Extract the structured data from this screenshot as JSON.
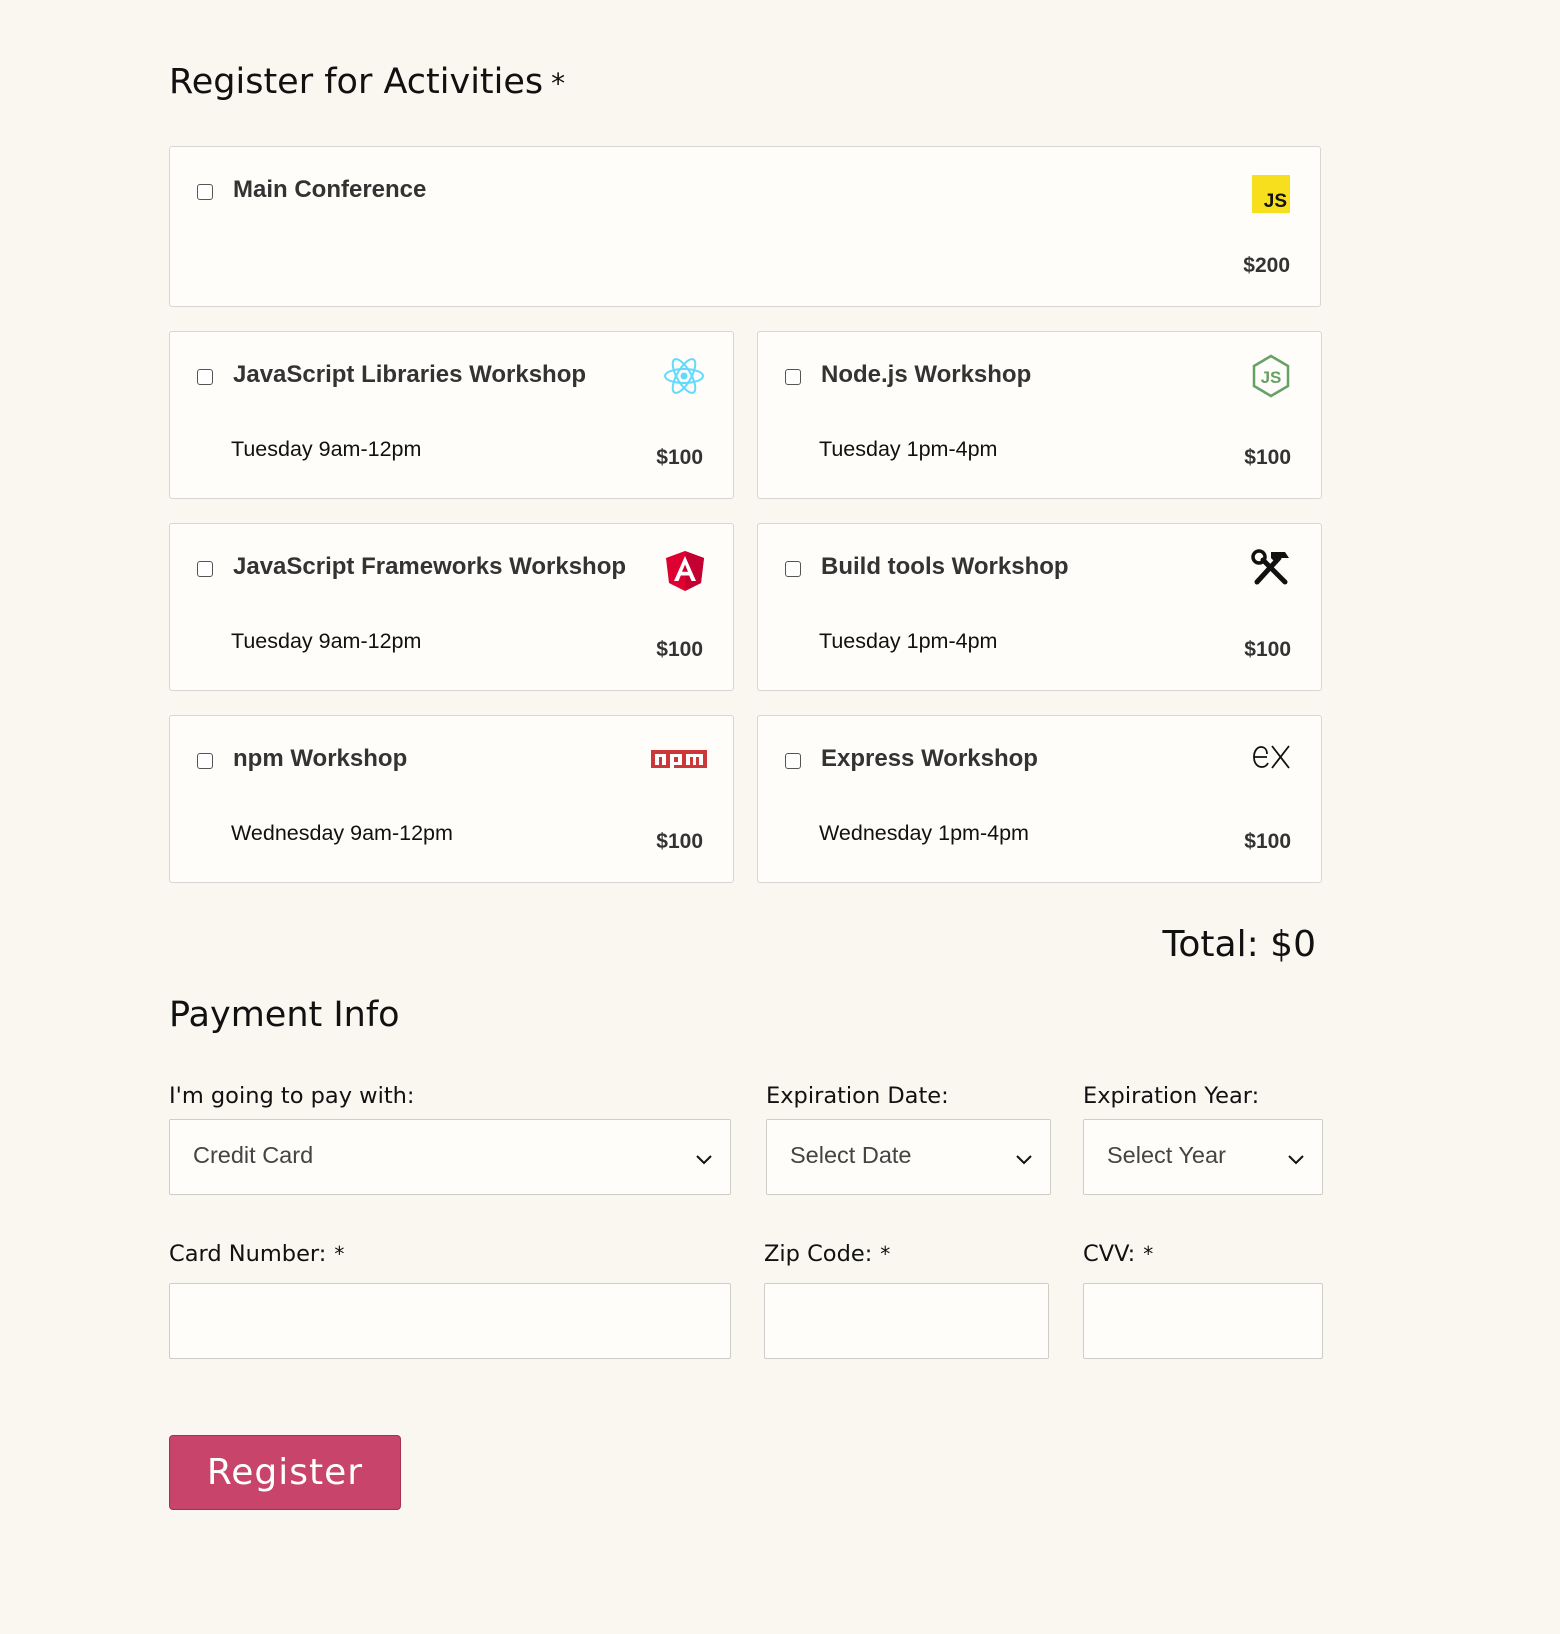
{
  "activities_section": {
    "title": "Register for Activities",
    "required_mark": "*",
    "main": {
      "name": "Main Conference",
      "cost": "$200",
      "icon": "js-logo-icon",
      "badge": "JS"
    },
    "workshops": [
      {
        "name": "JavaScript Libraries Workshop",
        "time": "Tuesday 9am-12pm",
        "cost": "$100",
        "icon": "react-icon"
      },
      {
        "name": "Node.js Workshop",
        "time": "Tuesday 1pm-4pm",
        "cost": "$100",
        "icon": "nodejs-icon"
      },
      {
        "name": "JavaScript Frameworks Workshop",
        "time": "Tuesday 9am-12pm",
        "cost": "$100",
        "icon": "angular-icon"
      },
      {
        "name": "Build tools Workshop",
        "time": "Tuesday 1pm-4pm",
        "cost": "$100",
        "icon": "build-tools-icon"
      },
      {
        "name": "npm Workshop",
        "time": "Wednesday 9am-12pm",
        "cost": "$100",
        "icon": "npm-icon"
      },
      {
        "name": "Express Workshop",
        "time": "Wednesday 1pm-4pm",
        "cost": "$100",
        "icon": "express-icon"
      }
    ],
    "total": "Total: $0"
  },
  "payment": {
    "title": "Payment Info",
    "pay_with_label": "I'm going to pay with:",
    "pay_with_value": "Credit Card",
    "exp_date_label": "Expiration Date:",
    "exp_date_value": "Select Date",
    "exp_year_label": "Expiration Year:",
    "exp_year_value": "Select Year",
    "card_number_label": "Card Number:",
    "zip_label": "Zip Code:",
    "cvv_label": "CVV:",
    "required_mark": "*",
    "card_number_value": "",
    "zip_value": "",
    "cvv_value": ""
  },
  "register_button": "Register",
  "colors": {
    "background": "#faf6f0",
    "register": "#c8446b",
    "js_yellow": "#f7df1e",
    "react": "#61dafb",
    "node": "#68a063",
    "angular": "#dd0031",
    "npm": "#cb3837"
  }
}
